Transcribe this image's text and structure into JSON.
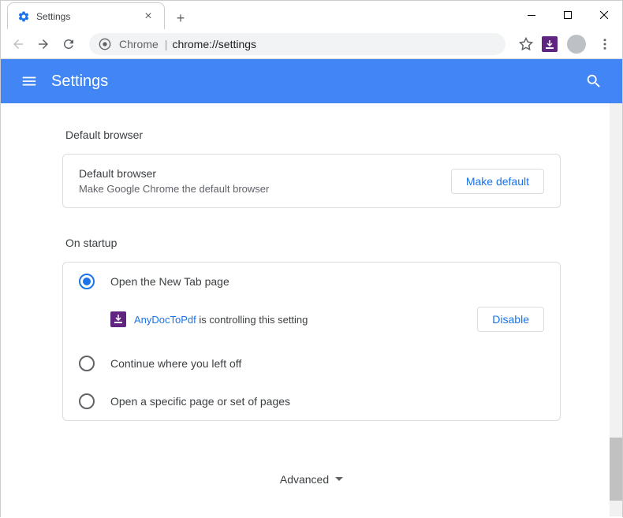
{
  "tab": {
    "title": "Settings"
  },
  "omnibox": {
    "prefix": "Chrome",
    "url": "chrome://settings"
  },
  "header": {
    "title": "Settings"
  },
  "sections": {
    "defaultBrowser": {
      "title": "Default browser",
      "label": "Default browser",
      "sublabel": "Make Google Chrome the default browser",
      "button": "Make default"
    },
    "onStartup": {
      "title": "On startup",
      "options": [
        {
          "label": "Open the New Tab page",
          "selected": true
        },
        {
          "label": "Continue where you left off",
          "selected": false
        },
        {
          "label": "Open a specific page or set of pages",
          "selected": false
        }
      ],
      "controlledBy": {
        "extensionName": "AnyDocToPdf",
        "text": " is controlling this setting",
        "button": "Disable"
      }
    }
  },
  "advanced": {
    "label": "Advanced"
  }
}
